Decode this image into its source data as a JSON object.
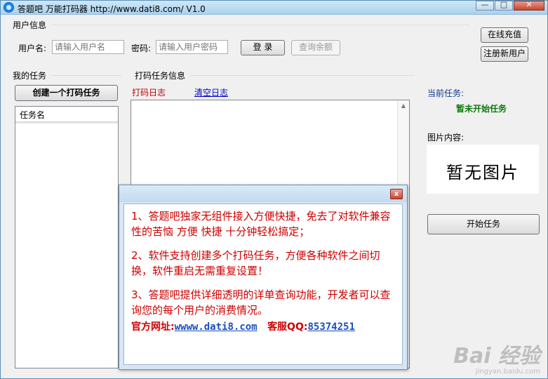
{
  "window": {
    "title": "答题吧 万能打码器 http://www.dati8.com/ V1.0",
    "controls": {
      "minimize": "—",
      "maximize": "□",
      "close": "✕"
    }
  },
  "user_info": {
    "group_label": "用户信息",
    "username_label": "用户名:",
    "username_placeholder": "请输入用户名",
    "password_label": "密码:",
    "password_placeholder": "请输入用户密码",
    "login_button": "登 录",
    "balance_button": "查询余额",
    "recharge_button": "在线充值",
    "register_button": "注册新用户"
  },
  "my_tasks": {
    "group_label": "我的任务",
    "create_button": "创建一个打码任务",
    "column_header": "任务名"
  },
  "task_info": {
    "group_label": "打码任务信息",
    "log_tab": "打码日志",
    "clear_log": "清空日志"
  },
  "right_panel": {
    "current_task_label": "当前任务:",
    "current_task_status": "暂未开始任务",
    "image_label": "图片内容:",
    "image_placeholder": "暂无图片",
    "start_button": "开始任务"
  },
  "popup": {
    "close": "x",
    "paragraphs": [
      "1、答题吧独家无组件接入方便快捷，免去了对软件兼容性的苦恼 方便 快捷 十分钟轻松搞定；",
      "2、软件支持创建多个打码任务，方便各种软件之间切换，软件重启无需重复设置！",
      "3、答题吧提供详细透明的详单查询功能，开发者可以查询您的每个用户的消费情况。"
    ],
    "site_label": "官方网址:",
    "site_link": "wwww.dati8.com",
    "qq_label": "客服QQ:",
    "qq_link": "85374251"
  },
  "watermark": {
    "main": "Bai 经验",
    "sub": "jingyan.baidu.com"
  }
}
